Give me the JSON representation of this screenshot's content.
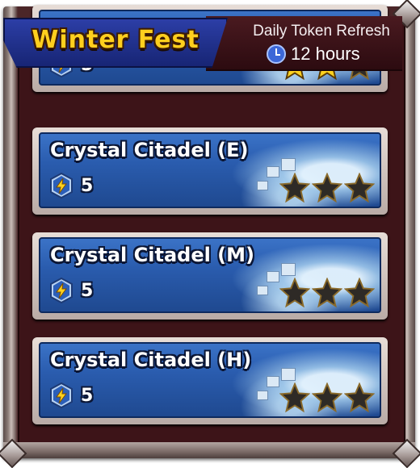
{
  "header": {
    "title": "Winter Fest",
    "refresh_label": "Daily Token Refresh",
    "refresh_time": "12 hours",
    "icon": "clock-icon"
  },
  "levels": [
    {
      "name": "",
      "cost": "5",
      "stars_earned": 2,
      "stars_total": 3,
      "partially_visible": true
    },
    {
      "name": "Crystal Citadel (E)",
      "cost": "5",
      "stars_earned": 0,
      "stars_total": 3
    },
    {
      "name": "Crystal Citadel (M)",
      "cost": "5",
      "stars_earned": 0,
      "stars_total": 3
    },
    {
      "name": "Crystal Citadel (H)",
      "cost": "5",
      "stars_earned": 0,
      "stars_total": 3
    }
  ],
  "colors": {
    "title_gold": "#ffcf1e",
    "card_blue": "#2a5cae",
    "star_gold": "#ffd21f",
    "star_empty": "#2e2a26"
  }
}
